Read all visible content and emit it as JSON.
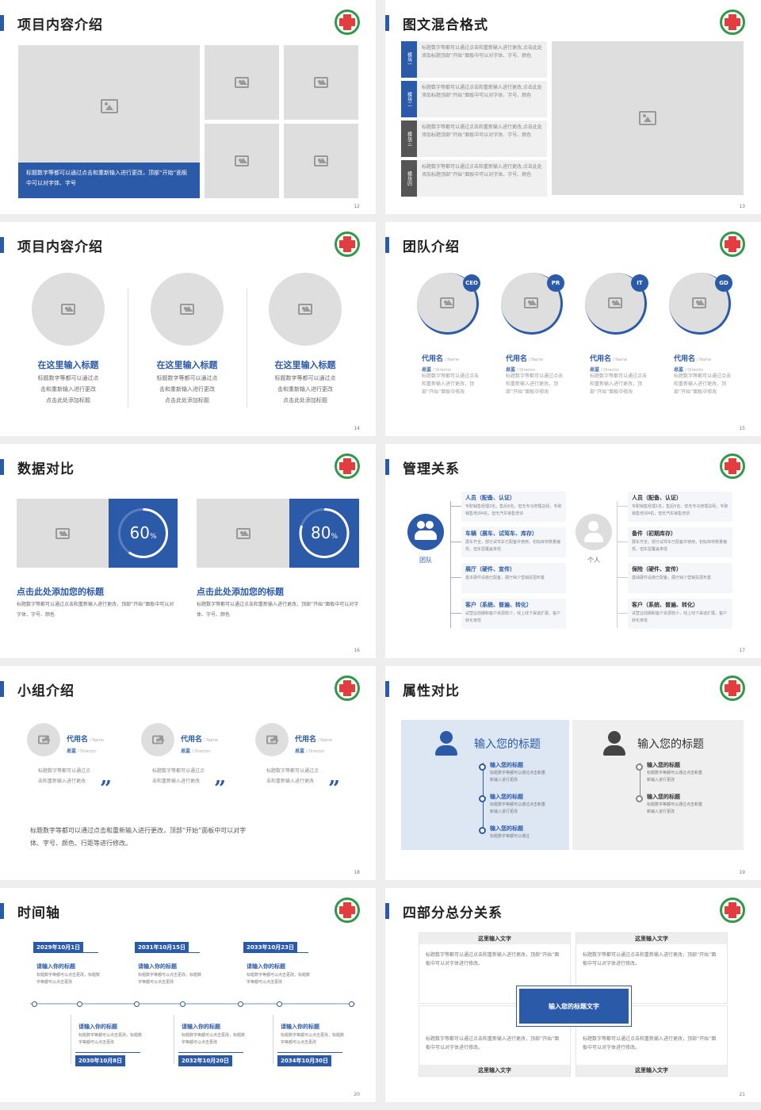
{
  "slides": {
    "s12": {
      "title": "项目内容介绍",
      "caption": "标题数字等都可以通过点击和重新输入进行更改，顶部“开始”面板中可以对字体、字号",
      "page": "12"
    },
    "s13": {
      "title": "图文混合格式",
      "tabs": [
        "模块一",
        "模块二",
        "模块三",
        "模块四"
      ],
      "text": "标题数字等都可以通过点击和重新输入进行更改,点击此处添加标题顶部“开始”面板中可以对字体、字号、颜色",
      "page": "13"
    },
    "s14": {
      "title": "项目内容介绍",
      "items": [
        {
          "h": "在这里输入标题",
          "t1": "标题数字等都可以通过点",
          "t2": "击和重新输入进行更改",
          "t3": "点击此处添加标题"
        },
        {
          "h": "在这里输入标题",
          "t1": "标题数字等都可以通过点",
          "t2": "击和重新输入进行更改",
          "t3": "点击此处添加标题"
        },
        {
          "h": "在这里输入标题",
          "t1": "标题数字等都可以通过点",
          "t2": "击和重新输入进行更改",
          "t3": "点击此处添加标题"
        }
      ],
      "page": "14"
    },
    "s15": {
      "title": "团队介绍",
      "members": [
        {
          "badge": "CEO",
          "name": "代用名",
          "ename": "/ Name",
          "role": "总监",
          "erole": "/ Director"
        },
        {
          "badge": "PR",
          "name": "代用名",
          "ename": "/ Name",
          "role": "总监",
          "erole": "/ Director"
        },
        {
          "badge": "IT",
          "name": "代用名",
          "ename": "/ Name",
          "role": "总监",
          "erole": "/ Director"
        },
        {
          "badge": "GD",
          "name": "代用名",
          "ename": "/ Name",
          "role": "总监",
          "erole": "/ Director"
        }
      ],
      "desc": "标题数字等都可以通过点击和重新输入进行更改，顶部“开始”面板中修改",
      "page": "15"
    },
    "s16": {
      "title": "数据对比",
      "cards": [
        {
          "pct": "60",
          "unit": "%",
          "value": 0.6,
          "h": "点击此处添加您的标题",
          "t": "标题数字等都可以通过点击和重新输入进行更改，顶部“开始”面板中可以对字体、字号、颜色"
        },
        {
          "pct": "80",
          "unit": "%",
          "value": 0.8,
          "h": "点击此处添加您的标题",
          "t": "标题数字等都可以通过点击和重新输入进行更改，顶部“开始”面板中可以对字体、字号、颜色"
        }
      ],
      "page": "16"
    },
    "s17": {
      "title": "管理关系",
      "team": "团队",
      "person": "个人",
      "left": [
        {
          "h": "人员（配备、认证）",
          "t": "专职销售经理2名，售后6名，但无专马管理总经，专职销售培训4名，但无汽车销售培训"
        },
        {
          "h": "车辆（展车、试驾车、库存）",
          "t": "展车齐全，部分试驾车已配备并使用，初始库存数量偏低，但车型覆盖率低"
        },
        {
          "h": "展厅（硬件、宣传）",
          "t": "基本硬件设施已配备，展厅缺少营销氛围布置"
        },
        {
          "h": "客户（系统、普遍、转化）",
          "t": "试营业前期和客户资源较少，线上线下渠道扩展，客户转化率低"
        }
      ],
      "right": [
        {
          "h": "人员（配备、认证）",
          "t": "专职销售经理1名，售后5名，但无专马管理总经，专职销售培训4名，但无汽车销售培训"
        },
        {
          "h": "备件（初期库存）",
          "t": "展车齐全，部分试驾车已配备并使用，初始库存数量偏低，但车型覆盖率低"
        },
        {
          "h": "保险（硬件、宣传）",
          "t": "基础硬件设施已配备，展厅缺少营销氛围布置"
        },
        {
          "h": "客户（系统、普遍、转化）",
          "t": "试营业前期和客户资源较少，线上线下渠道扩展，客户转化率低"
        }
      ],
      "page": "17"
    },
    "s18": {
      "title": "小组介绍",
      "members": [
        {
          "name": "代用名",
          "ename": "/ Name",
          "role": "总监",
          "erole": "/ Director"
        },
        {
          "name": "代用名",
          "ename": "/ Name",
          "role": "总监",
          "erole": "/ Director"
        },
        {
          "name": "代用名",
          "ename": "/ Name",
          "role": "总监",
          "erole": "/ Director"
        }
      ],
      "desc": "标题数字等都可以通过点击和重新输入进行更改",
      "footer": "标题数字等都可以通过点击和重新输入进行更改，顶部“开始”面板中可以对字体、字号、颜色、行距等进行修改。",
      "page": "18"
    },
    "s19": {
      "title": "属性对比",
      "left": {
        "h": "输入您的标题",
        "items": [
          {
            "h": "输入您的标题",
            "t": "标题数字等都可以通过点击和重新输入进行更改"
          },
          {
            "h": "输入您的标题",
            "t": "标题数字等都可以通过点击和重新输入进行更改"
          },
          {
            "h": "输入您的标题",
            "t": "标题数字等都可以通过"
          }
        ]
      },
      "right": {
        "h": "输入您的标题",
        "items": [
          {
            "h": "输入您的标题",
            "t": "标题数字等都可以通过点击和重新输入进行更改"
          },
          {
            "h": "输入您的标题",
            "t": "标题数字等都可以通过点击和重新输入进行更改"
          }
        ]
      },
      "page": "19"
    },
    "s20": {
      "title": "时间轴",
      "top": [
        {
          "date": "2029年10月1日",
          "h": "请输入你的标题",
          "t": "标题数字等都可以点击更改，标题数字等都可以点击更改"
        },
        {
          "date": "2031年10月15日",
          "h": "请输入你的标题",
          "t": "标题数字等都可以点击更改，标题数字等都可以点击更改"
        },
        {
          "date": "2033年10月23日",
          "h": "请输入你的标题",
          "t": "标题数字等都可以点击更改，标题数字等都可以点击更改"
        }
      ],
      "bottom": [
        {
          "date": "2030年10月8日",
          "h": "请输入你的标题",
          "t": "标题数字等都可以点击更改，标题数字等都可以点击更改"
        },
        {
          "date": "2032年10月20日",
          "h": "请输入你的标题",
          "t": "标题数字等都可以点击更改，标题数字等都可以点击更改"
        },
        {
          "date": "2034年10月30日",
          "h": "请输入你的标题",
          "t": "标题数字等都可以点击更改，标题数字等都可以点击更改"
        }
      ],
      "page": "20"
    },
    "s21": {
      "title": "四部分总分关系",
      "center": "输入您的标题文字",
      "label": "这里输入文字",
      "text": "标题数字等都可以通过点击和重新输入进行更改，顶部“开始”面板中可以对字体进行修改。",
      "page": "21"
    }
  }
}
